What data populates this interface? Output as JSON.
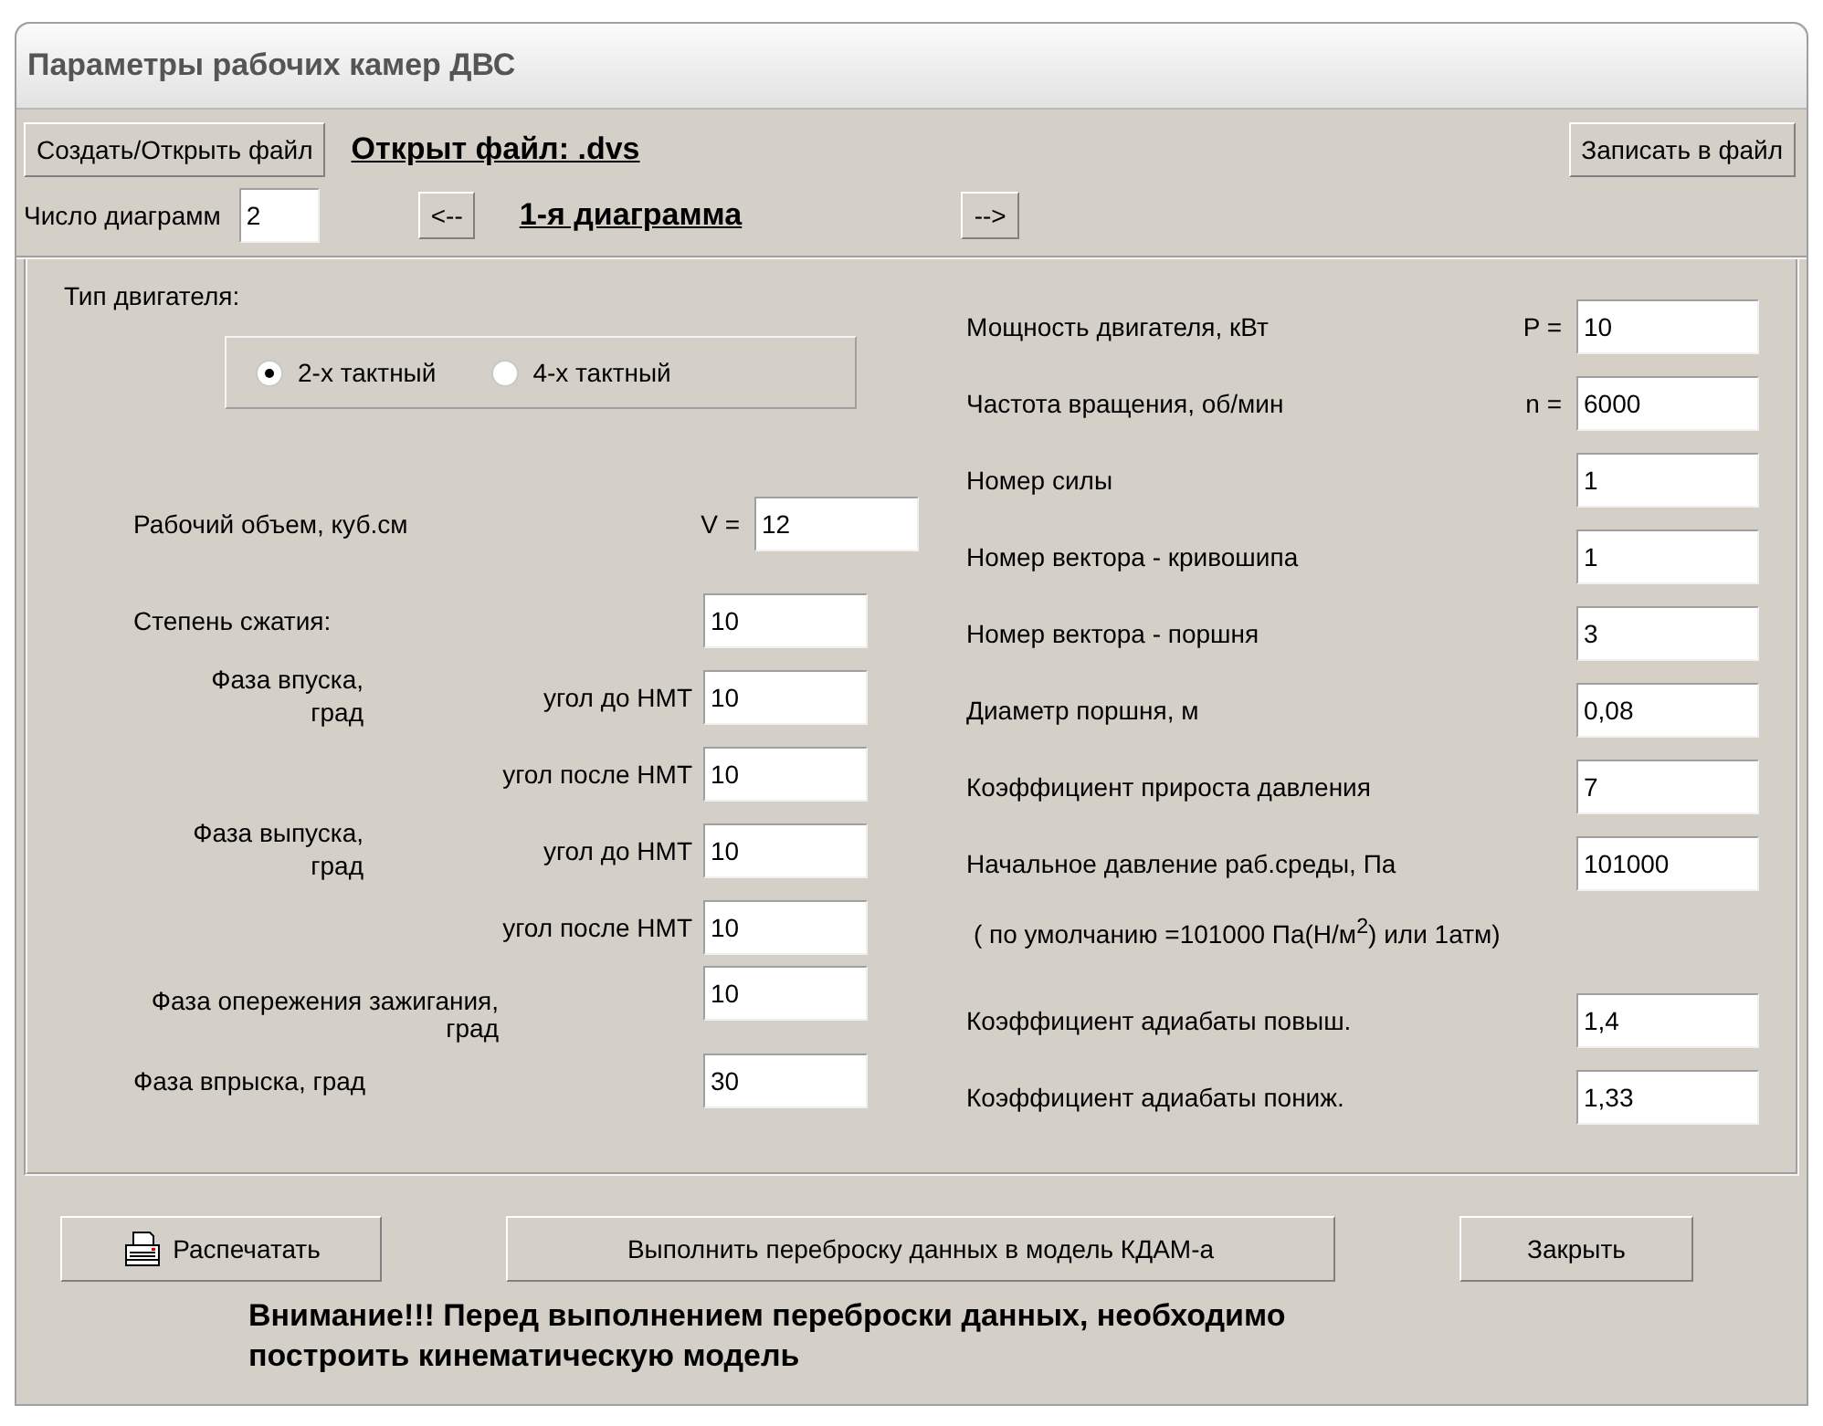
{
  "window": {
    "title": "Параметры рабочих камер ДВС"
  },
  "file_bar": {
    "open_button": "Создать/Открыть файл",
    "file_status": "Открыт файл: .dvs",
    "save_button": "Записать в файл"
  },
  "diagram_bar": {
    "count_label": "Число диаграмм",
    "count_value": "2",
    "prev_button": "<--",
    "current": "1-я диаграмма",
    "next_button": "-->"
  },
  "engine_type": {
    "label": "Тип двигателя:",
    "options": [
      {
        "label": "2-х тактный",
        "selected": true
      },
      {
        "label": "4-х тактный",
        "selected": false
      }
    ]
  },
  "left_rows": [
    {
      "kind": "volume",
      "label": "Рабочий объем, куб.см",
      "symbol": "V =",
      "value": "12"
    },
    {
      "kind": "field",
      "label": "Степень сжатия:",
      "value": "10"
    },
    {
      "kind": "phase",
      "label": "Фаза впуска, град",
      "rows": [
        {
          "label": "угол до НМТ",
          "value": "10"
        },
        {
          "label": "угол после НМТ",
          "value": "10"
        }
      ]
    },
    {
      "kind": "phase",
      "label": "Фаза выпуска, град",
      "rows": [
        {
          "label": "угол до НМТ",
          "value": "10"
        },
        {
          "label": "угол после НМТ",
          "value": "10"
        }
      ]
    },
    {
      "kind": "wrap",
      "label": "Фаза опережения зажигания, град",
      "value": "10"
    },
    {
      "kind": "field",
      "label": "Фаза впрыска, град",
      "value": "30"
    }
  ],
  "right_rows": [
    {
      "kind": "field",
      "label": "Мощность двигателя, кВт",
      "symbol": "P =",
      "value": "10"
    },
    {
      "kind": "field",
      "label": "Частота вращения, об/мин",
      "symbol": "n =",
      "value": "6000"
    },
    {
      "kind": "field",
      "label": "Номер силы",
      "value": "1"
    },
    {
      "kind": "field",
      "label": "Номер вектора - кривошипа",
      "value": "1"
    },
    {
      "kind": "field",
      "label": "Номер вектора - поршня",
      "value": "3"
    },
    {
      "kind": "field",
      "label": "Диаметр  поршня, м",
      "value": "0,08"
    },
    {
      "kind": "field",
      "label": "Коэффициент прироста давления",
      "value": "7"
    },
    {
      "kind": "field",
      "label": "Начальное давление раб.среды, Па",
      "value": "101000"
    },
    {
      "kind": "note",
      "label": "( по умолчанию =101000 Па(Н/м$^{2}$) или 1атм)"
    },
    {
      "kind": "field",
      "label": "Коэффициент адиабаты повыш.",
      "value": "1,4"
    },
    {
      "kind": "field",
      "label": "Коэффициент адиабаты пониж.",
      "value": "1,33"
    }
  ],
  "actions": {
    "print_button": "Распечатать",
    "transfer_button": "Выполнить переброску данных в модель КДАМ-а",
    "close_button": "Закрыть"
  },
  "warning": "Внимание!!! Перед выполнением переброски данных, необходимо построить кинематическую модель"
}
